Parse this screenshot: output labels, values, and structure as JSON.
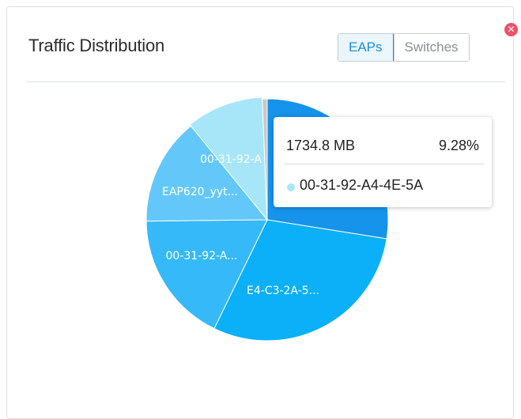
{
  "panel": {
    "title": "Traffic Distribution",
    "close_icon": "close-icon"
  },
  "toggle": {
    "options": [
      "EAPs",
      "Switches"
    ],
    "selected": "EAPs"
  },
  "chart_data": {
    "type": "pie",
    "slices": [
      {
        "label": "",
        "value": 25.0,
        "color": "#1693ea"
      },
      {
        "label": "E4-C3-2A-5...",
        "value": 27.0,
        "color": "#0bb0f9"
      },
      {
        "label": "00-31-92-A...",
        "value": 16.0,
        "color": "#35b9f8"
      },
      {
        "label": "EAP620_yyt...",
        "value": 13.0,
        "color": "#63c8f9"
      },
      {
        "label": "00-31-92-A",
        "value": 9.28,
        "color": "#a7e6f9"
      },
      {
        "label": "",
        "value": 0.6,
        "color": "#c9c9c9"
      }
    ],
    "highlighted": 4
  },
  "tooltip": {
    "size": "1734.8 MB",
    "percent": "9.28%",
    "name": "00-31-92-A4-4E-5A",
    "dot_color": "#a7e6f9"
  }
}
